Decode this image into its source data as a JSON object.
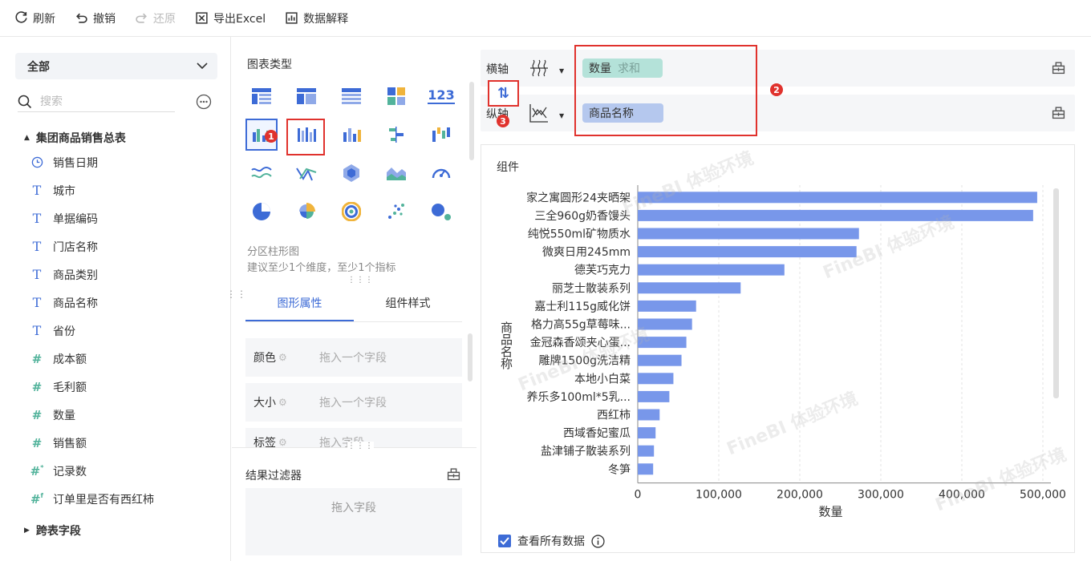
{
  "toolbar": {
    "refresh": "刷新",
    "undo": "撤销",
    "redo": "还原",
    "export": "导出Excel",
    "explain": "数据解释"
  },
  "left": {
    "dropdown": "全部",
    "search_placeholder": "搜索",
    "table_name": "集团商品销售总表",
    "fields": [
      {
        "label": "销售日期",
        "icon": "clock-icon"
      },
      {
        "label": "城市",
        "icon": "text-field-icon"
      },
      {
        "label": "单据编码",
        "icon": "text-field-icon"
      },
      {
        "label": "门店名称",
        "icon": "text-field-icon"
      },
      {
        "label": "商品类别",
        "icon": "text-field-icon"
      },
      {
        "label": "商品名称",
        "icon": "text-field-icon"
      },
      {
        "label": "省份",
        "icon": "text-field-icon"
      },
      {
        "label": "成本额",
        "icon": "number-field-icon"
      },
      {
        "label": "毛利额",
        "icon": "number-field-icon"
      },
      {
        "label": "数量",
        "icon": "number-field-icon"
      },
      {
        "label": "销售额",
        "icon": "number-field-icon"
      },
      {
        "label": "记录数",
        "icon": "count-field-icon"
      },
      {
        "label": "订单里是否有西红柿",
        "icon": "formula-field-icon"
      }
    ],
    "cross_table": "跨表字段"
  },
  "middle": {
    "chart_type_title": "图表类型",
    "chart_type_name": "分区柱形图",
    "chart_type_hint": "建议至少1个维度，至少1个指标",
    "tabs": [
      "图形属性",
      "组件样式"
    ],
    "props": [
      {
        "label": "颜色",
        "drop": "拖入一个字段"
      },
      {
        "label": "大小",
        "drop": "拖入一个字段"
      },
      {
        "label": "标签",
        "drop": "拖入字段"
      }
    ],
    "filter_title": "结果过滤器",
    "filter_drop": "拖入字段",
    "badges": [
      "1"
    ]
  },
  "axes": {
    "x_label": "横轴",
    "y_label": "纵轴",
    "x_field": "数量",
    "x_agg": "求和",
    "y_field": "商品名称",
    "badges": [
      "2",
      "3"
    ]
  },
  "component": {
    "title": "组件",
    "view_all": "查看所有数据",
    "watermark": "FineBI 体验环境"
  },
  "chart_data": {
    "type": "bar",
    "orientation": "horizontal",
    "categories": [
      "家之寓圆形24夹晒架",
      "三全960g奶香馒头",
      "纯悦550ml矿物质水",
      "微爽日用245mm",
      "德芙巧克力",
      "丽芝士散装系列",
      "嘉士利115g威化饼",
      "格力高55g草莓味...",
      "金冠森香颂夹心蛋...",
      "雕牌1500g洗洁精",
      "本地小白菜",
      "养乐多100ml*5乳...",
      "西红柿",
      "西域香妃蜜瓜",
      "盐津铺子散装系列",
      "冬笋"
    ],
    "values": [
      493000,
      488000,
      273000,
      270000,
      181000,
      127000,
      72000,
      67000,
      60000,
      54000,
      44000,
      39000,
      27000,
      22000,
      20000,
      19000
    ],
    "xlabel": "数量",
    "ylabel": "商品名称",
    "xlim": [
      0,
      500000
    ],
    "xticks": [
      "0",
      "100,000",
      "200,000",
      "300,000",
      "400,000",
      "500,000"
    ],
    "grid": true,
    "bar_color": "#7897ea"
  }
}
